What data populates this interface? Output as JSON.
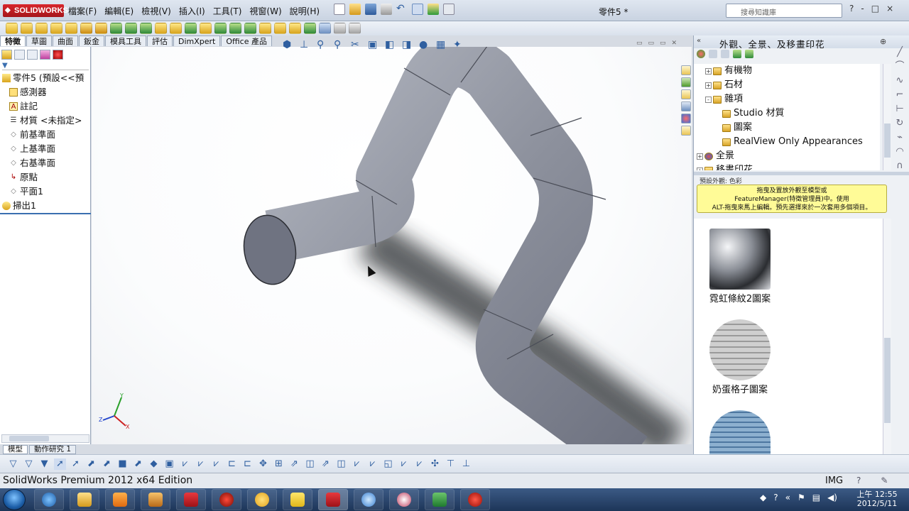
{
  "app": {
    "logo_text": "SOLIDWORKS",
    "document_title": "零件5 *",
    "menu": [
      "檔案(F)",
      "編輯(E)",
      "檢視(V)",
      "插入(I)",
      "工具(T)",
      "視窗(W)",
      "說明(H)"
    ],
    "search_placeholder": "搜尋知識庫",
    "window_controls": [
      "?",
      "-",
      "□",
      "×"
    ]
  },
  "command_tabs": [
    "特徵",
    "草圖",
    "曲面",
    "鈑金",
    "模具工具",
    "評估",
    "DimXpert",
    "Office 產品"
  ],
  "feature_tree": {
    "filter_icon": "filter-icon",
    "items": [
      {
        "label": "零件5  (預設<<預",
        "icon": "part-icon"
      },
      {
        "label": "感測器",
        "icon": "sensor-icon"
      },
      {
        "label": "註記",
        "icon": "annotation-icon"
      },
      {
        "label": "材質 <未指定>",
        "icon": "material-icon"
      },
      {
        "label": "前基準面",
        "icon": "plane-icon"
      },
      {
        "label": "上基準面",
        "icon": "plane-icon"
      },
      {
        "label": "右基準面",
        "icon": "plane-icon"
      },
      {
        "label": "原點",
        "icon": "origin-icon"
      },
      {
        "label": "平面1",
        "icon": "plane-icon"
      },
      {
        "label": "掃出1",
        "icon": "sweep-icon"
      }
    ]
  },
  "bottom_tabs": [
    "模型",
    "動作研究 1"
  ],
  "task_pane": {
    "title": "外觀、全景、及移畫印花",
    "tree": [
      {
        "label": "有機物",
        "level": 1,
        "expander": "+"
      },
      {
        "label": "石材",
        "level": 1,
        "expander": "+"
      },
      {
        "label": "雜項",
        "level": 1,
        "expander": "-"
      },
      {
        "label": "Studio 材質",
        "level": 2,
        "expander": ""
      },
      {
        "label": "圖案",
        "level": 2,
        "expander": ""
      },
      {
        "label": "RealView Only Appearances",
        "level": 2,
        "expander": ""
      },
      {
        "label": "全景",
        "level": 0,
        "expander": "+"
      },
      {
        "label": "移畫印花",
        "level": 0,
        "expander": "+"
      }
    ],
    "default_label": "預設外觀: 色彩",
    "hint_lines": [
      "拖曳及置放外觀至模型或",
      "FeatureManager(特徵管理員)中。使用",
      "ALT-拖曳來馬上編輯。預先選擇來於一次套用多個項目。"
    ],
    "gallery": [
      {
        "label": "霓虹條紋2圖案",
        "color": "#5c6066"
      },
      {
        "label": "奶蛋格子圖案",
        "color": "#b9b9b9"
      },
      {
        "label": "",
        "color": "#5f86a9"
      }
    ]
  },
  "status_bar": {
    "edition": "SolidWorks Premium 2012 x64 Edition",
    "units": "IMG"
  },
  "taskbar": {
    "clock_period": "上午 12:55",
    "clock_date": "2012/5/11"
  },
  "colors": {
    "pipe": "#8c909c",
    "pipe_dark": "#6e7280",
    "pipe_light": "#b4b8c2",
    "accent": "#3b6fb0"
  }
}
